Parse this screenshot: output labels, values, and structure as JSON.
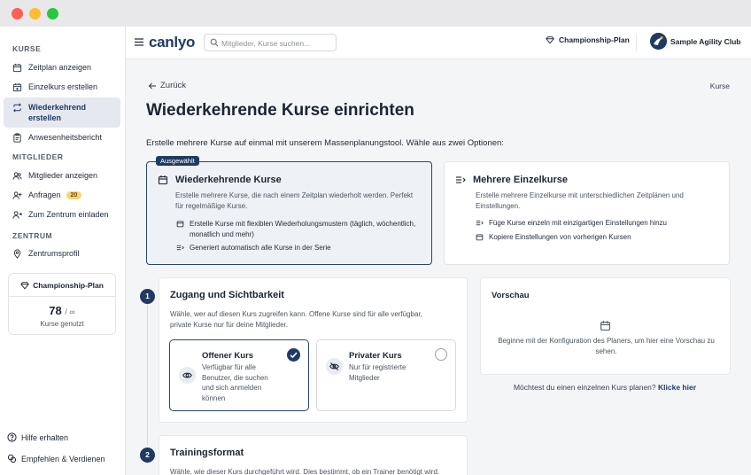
{
  "sidebar": {
    "sections": {
      "kurse": "KURSE",
      "mitglieder": "MITGLIEDER",
      "zentrum": "ZENTRUM"
    },
    "items": [
      {
        "label": "Zeitplan anzeigen",
        "icon": "calendar-icon"
      },
      {
        "label": "Einzelkurs erstellen",
        "icon": "calendar-plus-icon"
      },
      {
        "label": "Wiederkehrend erstellen",
        "icon": "repeat-icon",
        "active": true
      },
      {
        "label": "Anwesenheitsbericht",
        "icon": "clipboard-icon"
      },
      {
        "label": "Mitglieder anzeigen",
        "icon": "users-icon"
      },
      {
        "label": "Anfragen",
        "icon": "user-add-icon",
        "badge": "20"
      },
      {
        "label": "Zum Zentrum einladen",
        "icon": "user-invite-icon"
      },
      {
        "label": "Zentrumsprofil",
        "icon": "map-pin-icon"
      }
    ],
    "plan": {
      "title": "Championship-Plan",
      "count": "78",
      "limit": "∞",
      "sub": "Kurse genutzt"
    },
    "bottom": {
      "help": "Hilfe erhalten",
      "refer": "Empfehlen & Verdienen"
    }
  },
  "topbar": {
    "logo": "canlyo",
    "search_placeholder": "Mitglieder, Kurse suchen...",
    "plan": "Championship-Plan",
    "club": "Sample Agility Club"
  },
  "main": {
    "back": "Zurück",
    "breadcrumb": "Kurse",
    "title": "Wiederkehrende Kurse einrichten",
    "intro": "Erstelle mehrere Kurse auf einmal mit unserem Massenplanungstool. Wähle aus zwei Optionen:",
    "options": {
      "selected_tag": "Ausgewählt",
      "recurring": {
        "title": "Wiederkehrende Kurse",
        "desc": "Erstelle mehrere Kurse, die nach einem Zeitplan wiederholt werden. Perfekt für regelmäßige Kurse.",
        "feat1": "Erstelle Kurse mit flexiblen Wiederholungsmustern (täglich, wöchentlich, monatlich und mehr)",
        "feat2": "Generiert automatisch alle Kurse in der Serie"
      },
      "multiple": {
        "title": "Mehrere Einzelkurse",
        "desc": "Erstelle mehrere Einzelkurse mit unterschiedlichen Zeitplänen und Einstellungen.",
        "feat1": "Füge Kurse einzeln mit einzigartigen Einstellungen hinzu",
        "feat2": "Kopiere Einstellungen von vorherigen Kursen"
      }
    },
    "step1": {
      "number": "1",
      "title": "Zugang und Sichtbarkeit",
      "desc": "Wähle, wer auf diesen Kurs zugreifen kann. Offene Kurse sind für alle verfügbar, private Kurse nur für deine Mitglieder.",
      "open": {
        "title": "Offener Kurs",
        "desc": "Verfügbar für alle Benutzer, die suchen und sich anmelden können"
      },
      "private": {
        "title": "Privater Kurs",
        "desc": "Nur für registrierte Mitglieder"
      }
    },
    "step2": {
      "number": "2",
      "title": "Trainingsformat",
      "desc": "Wähle, wie dieser Kurs durchgeführt wird. Dies bestimmt, ob ein Trainer benötigt wird."
    },
    "preview": {
      "title": "Vorschau",
      "text": "Beginne mit der Konfiguration des Planers, um hier eine Vorschau zu sehen."
    },
    "single_prompt": "Möchtest du einen einzelnen Kurs planen?",
    "single_link": "Klicke hier"
  },
  "colors": {
    "accent": "#1f3b63",
    "badge": "#f7d37a"
  }
}
